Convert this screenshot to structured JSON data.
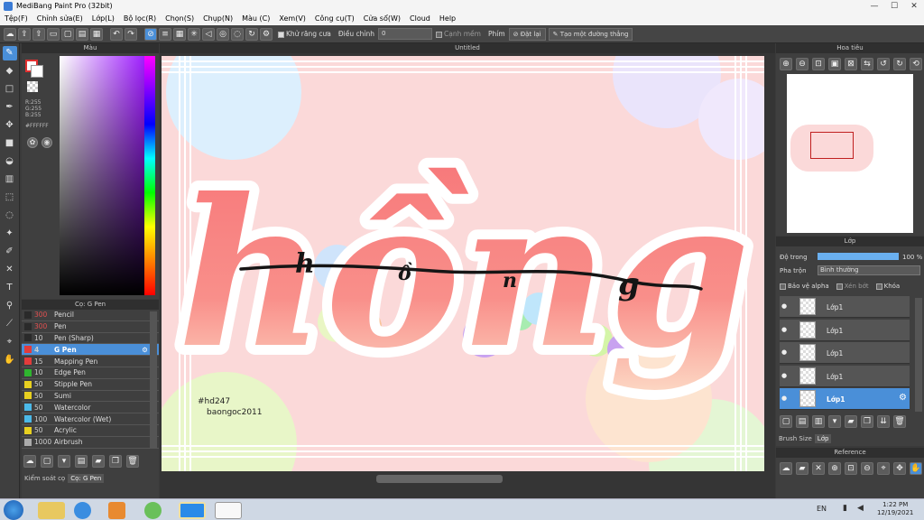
{
  "window": {
    "title": "MediBang Paint Pro (32bit)"
  },
  "menu": [
    "Tệp(F)",
    "Chỉnh sửa(E)",
    "Lớp(L)",
    "Bộ lọc(R)",
    "Chọn(S)",
    "Chụp(N)",
    "Màu (C)",
    "Xem(V)",
    "Công cụ(T)",
    "Cửa sổ(W)",
    "Cloud",
    "Help"
  ],
  "toolbar": {
    "antialias_label": "Khử răng cưa",
    "adjust_label": "Điều chỉnh",
    "adjust_value": "0",
    "soft_edge_label": "Cạnh mềm",
    "key_label": "Phím",
    "reset_label": "Đặt lại",
    "line_label": "Tạo một đường thẳng"
  },
  "color_panel": {
    "title": "Màu",
    "r": "R:255",
    "g": "G:255",
    "b": "B:255",
    "hex": "#FFFFFF"
  },
  "brush_panel": {
    "title": "Cọ: G Pen",
    "brushes": [
      {
        "size": "300",
        "name": "Pencil",
        "color": "#2a2a2a"
      },
      {
        "size": "300",
        "name": "Pen",
        "color": "#2a2a2a"
      },
      {
        "size": "10",
        "name": "Pen (Sharp)",
        "color": "#2a2a2a"
      },
      {
        "size": "4",
        "name": "G Pen",
        "color": "#e23b3b"
      },
      {
        "size": "15",
        "name": "Mapping Pen",
        "color": "#e23b3b"
      },
      {
        "size": "10",
        "name": "Edge Pen",
        "color": "#2fb52f"
      },
      {
        "size": "50",
        "name": "Stipple Pen",
        "color": "#e8d020"
      },
      {
        "size": "50",
        "name": "Sumi",
        "color": "#e8d020"
      },
      {
        "size": "50",
        "name": "Watercolor",
        "color": "#4bb9e8"
      },
      {
        "size": "100",
        "name": "Watercolor (Wet)",
        "color": "#4bb9e8"
      },
      {
        "size": "50",
        "name": "Acrylic",
        "color": "#e8d020"
      },
      {
        "size": "1000",
        "name": "Airbrush",
        "color": "#aaaaaa"
      }
    ],
    "tab_control": "Kiểm soát cọ",
    "tab_brush": "Cọ: G Pen"
  },
  "canvas": {
    "tab_title": "Untitled",
    "art_text": "hồng",
    "art_line_letters": [
      "h",
      "ồ",
      "n",
      "g"
    ],
    "sign_line1": "#hd247",
    "sign_line2": "baongoc2011"
  },
  "navigator": {
    "title": "Hoa tiêu"
  },
  "layer_panel": {
    "title": "Lớp",
    "opacity_label": "Độ trong",
    "opacity_value": "100 %",
    "opacity_fraction": 1.0,
    "blend_label": "Pha trộn",
    "blend_value": "Bình thường",
    "protect_alpha": "Bảo vệ alpha",
    "clipping": "Xén bớt",
    "lock": "Khóa",
    "layers": [
      "Lớp1",
      "Lớp1",
      "Lớp1",
      "Lớp1",
      "Lớp1"
    ],
    "tab_brush_size": "Brush Size",
    "tab_layer": "Lớp"
  },
  "reference_panel": {
    "title": "Reference"
  },
  "taskbar": {
    "lang": "EN",
    "time": "1:22 PM",
    "date": "12/19/2021"
  },
  "colors": {
    "accent": "#4a8fd8",
    "canvas_pink": "#fbd9d9",
    "letter_coral": "#f5857f"
  }
}
